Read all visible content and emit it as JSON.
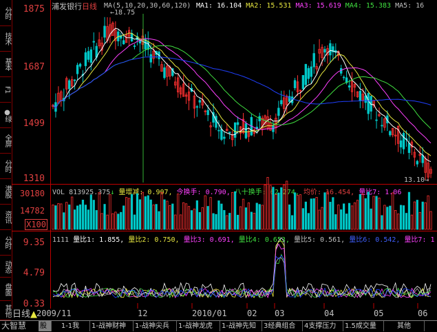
{
  "left_tabs": [
    "分时",
    "技术",
    "基本",
    "F1",
    "●绿",
    "全屏",
    "分时",
    "港股",
    "资讯",
    "分时",
    "动态",
    "盘面",
    "其他"
  ],
  "main_header": {
    "stock_name": "浦发银行",
    "period": "日线",
    "ma_params": "MA(5,10,20,30,60,120)",
    "ma1": "MA1: 16.104",
    "ma2": "MA2: 15.531",
    "ma3": "MA3: 15.619",
    "ma4": "MA4: 15.383",
    "ma5": "MA5: 16"
  },
  "price_axis": [
    "1875",
    "1687",
    "1499",
    "1310"
  ],
  "annotations": {
    "high": "18.75",
    "low": "13.10"
  },
  "vol_header": {
    "vol": "VOL 813925.375",
    "lh": "量增减: 0.907,",
    "turnover": "今换手: 0.790,",
    "turnover80": "八十换手: 62.274,",
    "avgprice": "均价: 16.454,",
    "ratio7": "量比7: 1.06"
  },
  "vol_axis": [
    "30180",
    "14782",
    "X100"
  ],
  "ratio_header": {
    "id": "1111",
    "r1": "量比1: 1.855,",
    "r2": "量比2: 0.750,",
    "r3": "量比3: 0.691,",
    "r4": "量比4: 0.653,",
    "r5": "量比5: 0.561,",
    "r6": "量比6: 0.542,",
    "r7": "量比7: 1"
  },
  "ratio_axis": [
    "9.35",
    "4.79",
    "0.33"
  ],
  "date_labels": [
    "2009/11",
    "12",
    "2010/01",
    "02",
    "03",
    "04",
    "05",
    "06"
  ],
  "bottom_left": {
    "period": "日线",
    "brand": "大智慧"
  },
  "bottom_tabs": [
    "股",
    "1-1我",
    "1-战神财神",
    "1-战神尖兵",
    "1-战神龙虎",
    "1-战神先知",
    "3经典组合",
    "4支撑压力",
    "1.5成交量",
    "其他"
  ],
  "colors": {
    "up": "#ff3030",
    "down": "#00c8c8",
    "axis": "#c00000",
    "ma1": "#ffffff",
    "ma2": "#e8e840",
    "ma3": "#ff40ff",
    "ma4": "#40e040",
    "ma5": "#2040ff"
  }
}
